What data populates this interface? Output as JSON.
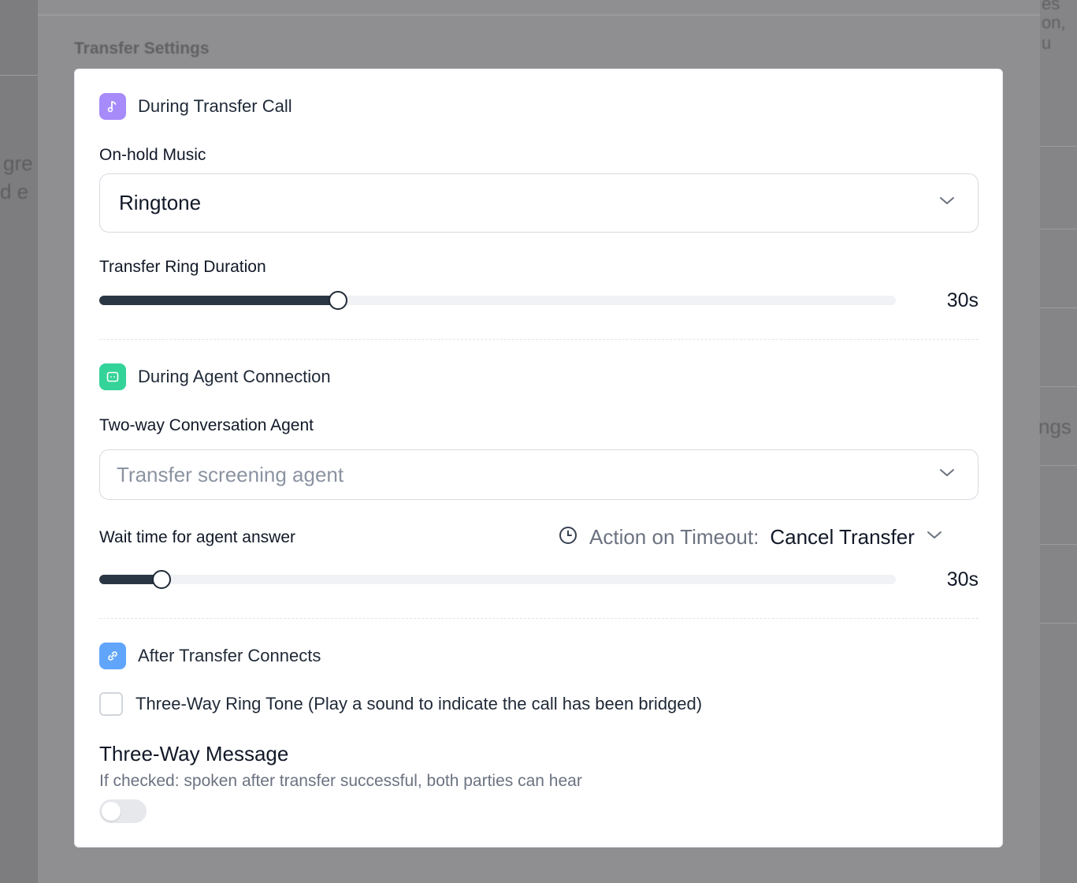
{
  "background": {
    "title": "Transfer Settings",
    "fragments": [
      "gre",
      "d e",
      "ngs",
      "es",
      "on, u"
    ]
  },
  "modal": {
    "sections": {
      "transfer_call": {
        "title": "During Transfer Call",
        "icon": "music-note-icon",
        "icon_color": "#a78bfa",
        "onhold_label": "On-hold Music",
        "onhold_value": "Ringtone",
        "ring_duration_label": "Transfer Ring Duration",
        "ring_duration_value": "30s",
        "ring_duration_fraction": 0.3
      },
      "agent_connection": {
        "title": "During Agent Connection",
        "icon": "chat-bubble-icon",
        "icon_color": "#34d399",
        "agent_label": "Two-way Conversation Agent",
        "agent_placeholder": "Transfer screening agent",
        "wait_label": "Wait time for agent answer",
        "timeout_label": "Action on Timeout:",
        "timeout_value": "Cancel Transfer",
        "wait_value": "30s",
        "wait_fraction": 0.078
      },
      "after_connect": {
        "title": "After Transfer Connects",
        "icon": "link-icon",
        "icon_color": "#60a5fa",
        "ringtone_checkbox_label": "Three-Way Ring Tone (Play a sound to indicate the call has been bridged)",
        "ringtone_checked": false,
        "message_title": "Three-Way Message",
        "message_subtitle": "If checked: spoken after transfer successful, both parties can hear",
        "message_enabled": false
      }
    }
  },
  "colors": {
    "slider_fill": "#2b3645",
    "accent_purple": "#a78bfa",
    "accent_green": "#34d399",
    "accent_blue": "#60a5fa"
  }
}
